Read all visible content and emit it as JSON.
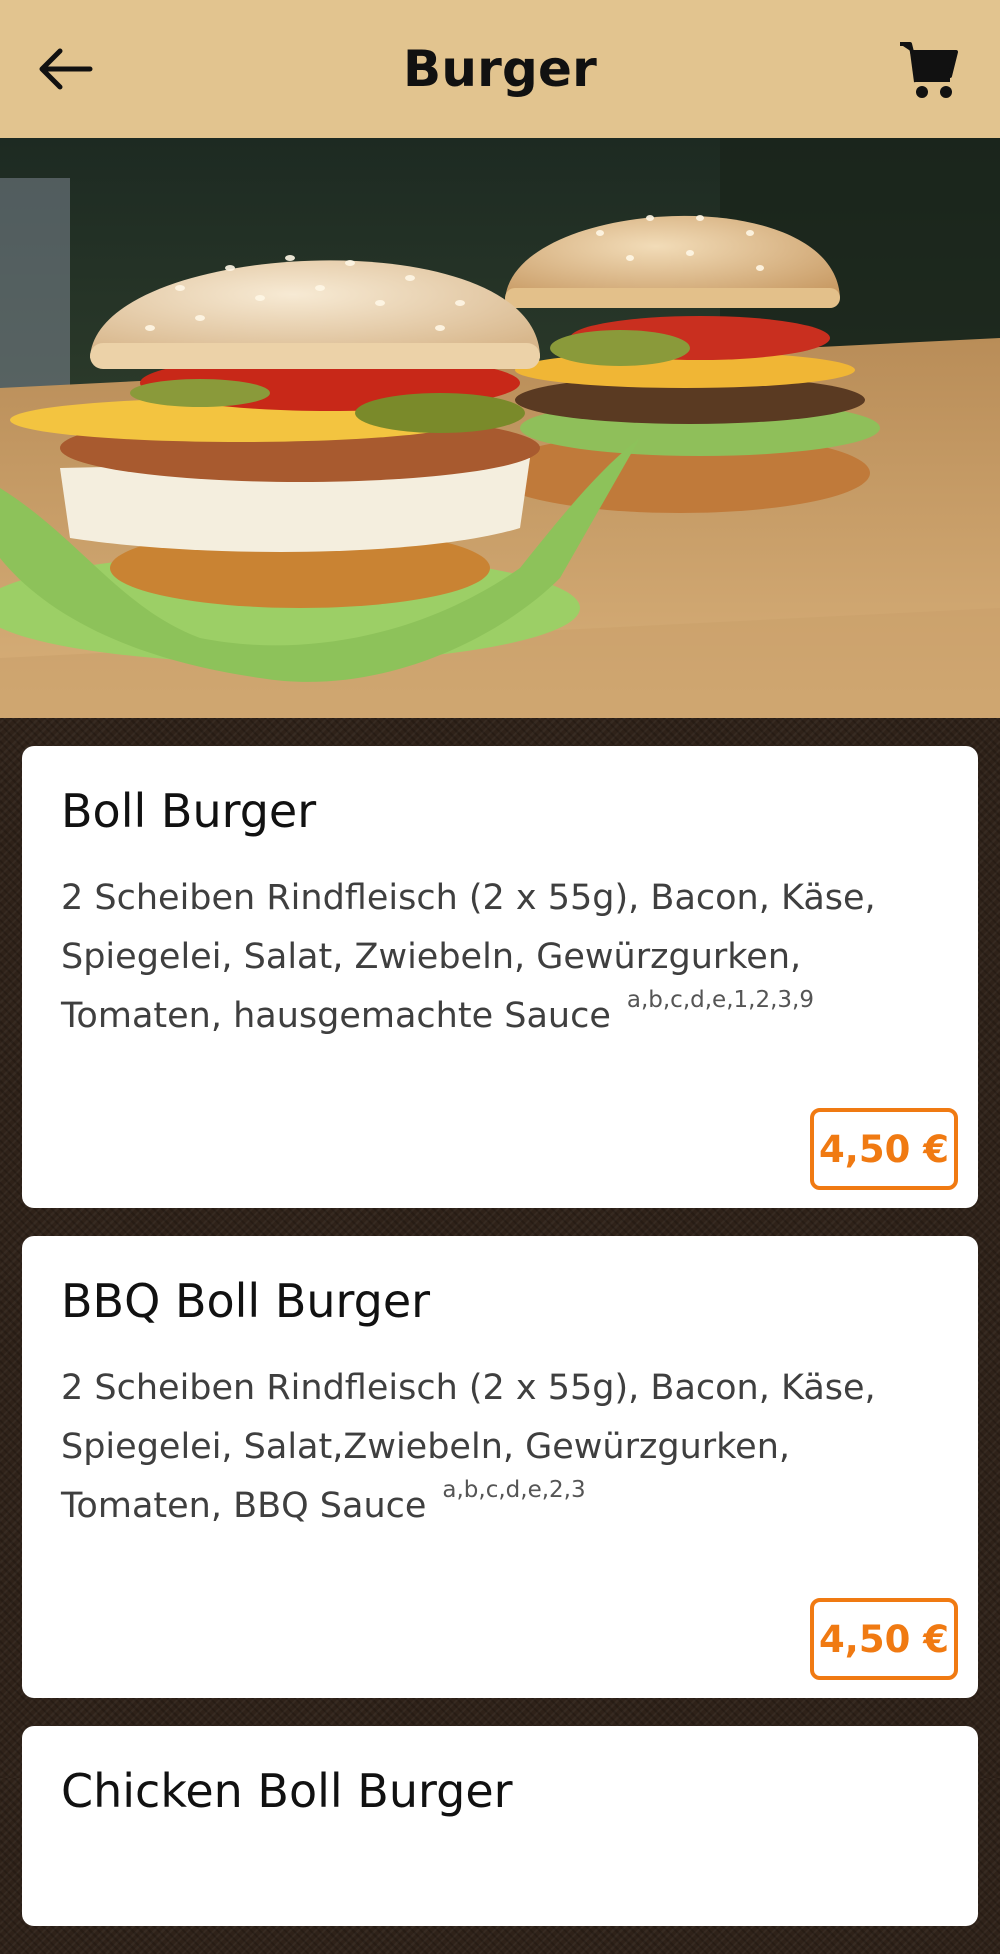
{
  "header": {
    "title": "Burger",
    "back_icon": "arrow-left-icon",
    "cart_icon": "shopping-cart-icon"
  },
  "hero": {
    "image": "burger-photo"
  },
  "colors": {
    "header_bg": "#e2c48f",
    "page_bg": "#2f2219",
    "price_accent": "#f07a12"
  },
  "menu": {
    "items": [
      {
        "name": "Boll Burger",
        "description": "2 Scheiben Rindfleisch (2 x 55g), Bacon, Käse, Spiegelei, Salat, Zwiebeln, Gewürzgurken, Tomaten, hausgemachte Sauce",
        "allergens": "a,b,c,d,e,1,2,3,9",
        "price": "4,50 €"
      },
      {
        "name": "BBQ Boll Burger",
        "description": "2 Scheiben Rindfleisch (2 x 55g), Bacon, Käse, Spiegelei, Salat,Zwiebeln, Gewürzgurken, Tomaten, BBQ Sauce",
        "allergens": "a,b,c,d,e,2,3",
        "price": "4,50 €"
      },
      {
        "name": "Chicken Boll Burger"
      }
    ]
  }
}
